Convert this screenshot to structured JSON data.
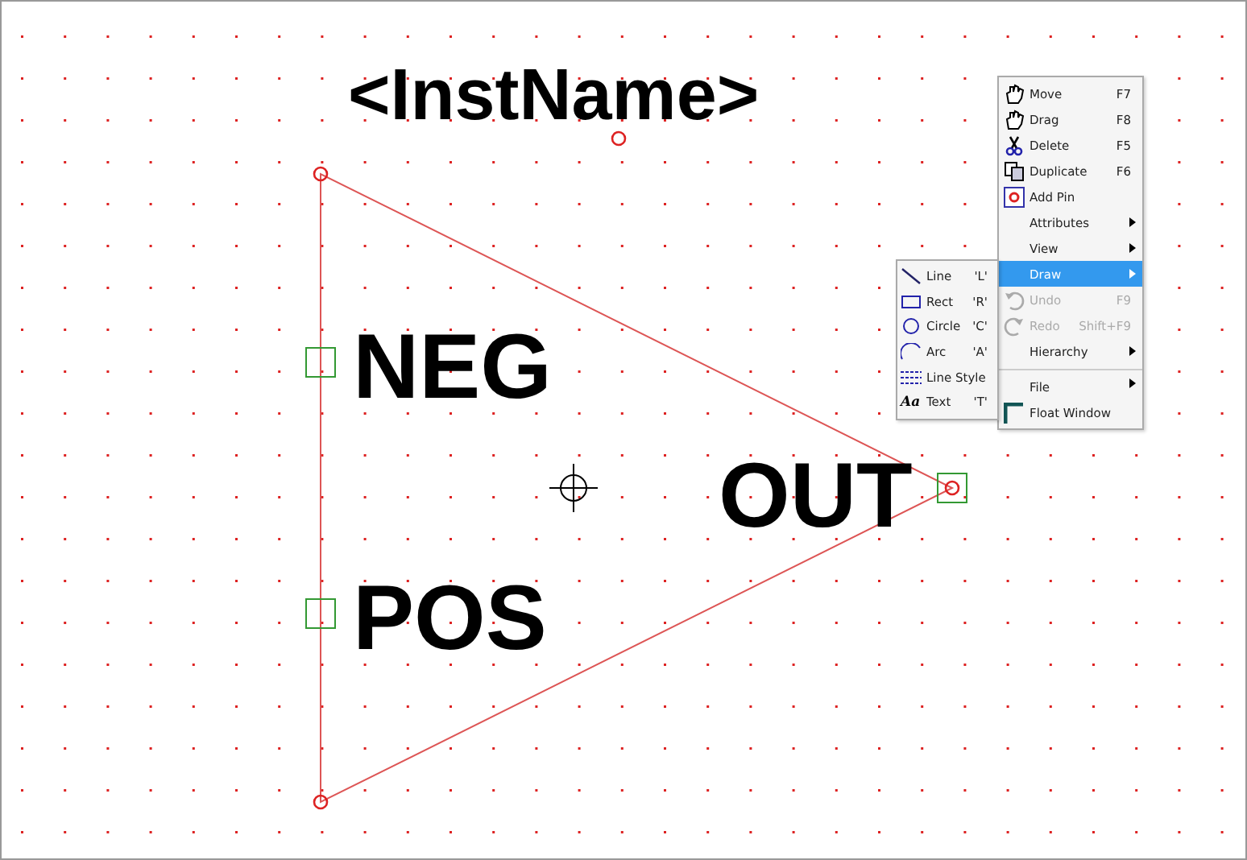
{
  "canvas": {
    "instance_name": "<InstName>",
    "pins": [
      {
        "label": "NEG"
      },
      {
        "label": "POS"
      },
      {
        "label": "OUT"
      }
    ]
  },
  "context_menu": {
    "items": [
      {
        "label": "Move",
        "shortcut": "F7",
        "submenu": false,
        "disabled": false,
        "selected": false,
        "divider_above": false
      },
      {
        "label": "Drag",
        "shortcut": "F8",
        "submenu": false,
        "disabled": false,
        "selected": false,
        "divider_above": false
      },
      {
        "label": "Delete",
        "shortcut": "F5",
        "submenu": false,
        "disabled": false,
        "selected": false,
        "divider_above": false
      },
      {
        "label": "Duplicate",
        "shortcut": "F6",
        "submenu": false,
        "disabled": false,
        "selected": false,
        "divider_above": false
      },
      {
        "label": "Add Pin",
        "submenu": false,
        "disabled": false,
        "selected": false,
        "divider_above": false
      },
      {
        "label": "Attributes",
        "submenu": true,
        "disabled": false,
        "selected": false,
        "divider_above": false
      },
      {
        "label": "View",
        "submenu": true,
        "disabled": false,
        "selected": false,
        "divider_above": false
      },
      {
        "label": "Draw",
        "submenu": true,
        "disabled": false,
        "selected": true,
        "divider_above": false
      },
      {
        "label": "Undo",
        "shortcut": "F9",
        "submenu": false,
        "disabled": true,
        "selected": false,
        "divider_above": false
      },
      {
        "label": "Redo",
        "shortcut": "Shift+F9",
        "submenu": false,
        "disabled": true,
        "selected": false,
        "divider_above": false
      },
      {
        "label": "Hierarchy",
        "submenu": true,
        "disabled": false,
        "selected": false,
        "divider_above": false
      },
      {
        "label": "File",
        "submenu": true,
        "disabled": false,
        "selected": false,
        "divider_above": true
      },
      {
        "label": "Float Window",
        "submenu": false,
        "disabled": false,
        "selected": false,
        "divider_above": false
      }
    ]
  },
  "draw_submenu": {
    "items": [
      {
        "label": "Line",
        "shortcut": "'L'"
      },
      {
        "label": "Rect",
        "shortcut": "'R'"
      },
      {
        "label": "Circle",
        "shortcut": "'C'"
      },
      {
        "label": "Arc",
        "shortcut": "'A'"
      },
      {
        "label": "Line Style"
      },
      {
        "label": "Text",
        "shortcut": "'T'",
        "icon_text": "Aa"
      }
    ]
  }
}
